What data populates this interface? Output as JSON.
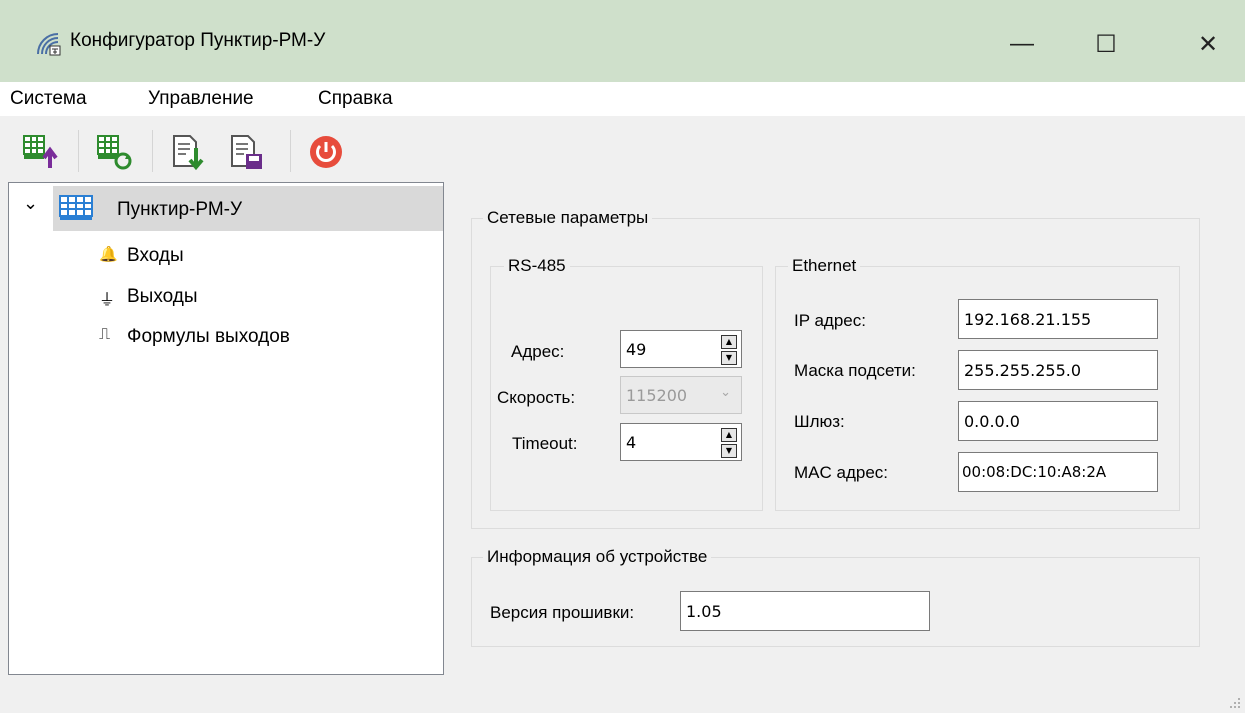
{
  "window": {
    "title": "Конфигуратор Пунктир-РМ-У",
    "minimize_glyph": "—",
    "maximize_glyph": "☐",
    "close_glyph": "✕"
  },
  "menu": [
    "Система",
    "Управление",
    "Справка"
  ],
  "toolbar": {
    "buttons": [
      "upload-to-device-icon",
      "sync-device-icon",
      "import-config-icon",
      "save-config-icon",
      "power-icon"
    ],
    "power_color": "#e74c3c"
  },
  "tree": {
    "root": "Пунктир-РМ-У",
    "expander_glyph": "⌄",
    "children": [
      {
        "label": "Входы",
        "icon": "bell-icon",
        "glyph": "🔔"
      },
      {
        "label": "Выходы",
        "icon": "outputs-icon",
        "glyph": "⏚"
      },
      {
        "label": "Формулы выходов",
        "icon": "pulse-icon",
        "glyph": "⎍"
      }
    ]
  },
  "network": {
    "title": "Сетевые параметры",
    "rs485": {
      "title": "RS-485",
      "address_label": "Адрес:",
      "address": "49",
      "speed_label": "Скорость:",
      "speed": "115200",
      "timeout_label": "Timeout:",
      "timeout": "4"
    },
    "ethernet": {
      "title": "Ethernet",
      "ip_label": "IP адрес:",
      "ip": "192.168.21.155",
      "mask_label": "Маска подсети:",
      "mask": "255.255.255.0",
      "gateway_label": "Шлюз:",
      "gateway": "0.0.0.0",
      "mac_label": "MAC адрес:",
      "mac": "00:08:DC:10:A8:2A"
    }
  },
  "device_info": {
    "title": "Информация об устройстве",
    "firmware_label": "Версия прошивки:",
    "firmware": "1.05"
  },
  "colors": {
    "titlebar": "#cfe0cb",
    "selection": "#d9d9d9",
    "accent_blue": "#2a7fd4",
    "accent_green": "#3c9a3c"
  }
}
